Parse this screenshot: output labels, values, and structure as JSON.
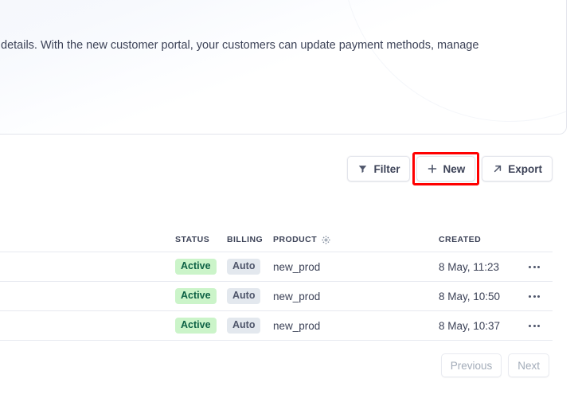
{
  "promo": {
    "text": "details. With the new customer portal, your customers can update payment methods, manage"
  },
  "toolbar": {
    "filter_label": "Filter",
    "filter_icon": "filter-funnel-icon",
    "new_label": "New",
    "new_icon": "plus-icon",
    "export_label": "Export",
    "export_icon": "arrow-up-right-icon",
    "highlight_color": "#ff0000"
  },
  "table": {
    "headers": {
      "spacer": "",
      "status": "STATUS",
      "billing": "BILLING",
      "product": "PRODUCT",
      "product_icon": "gear-icon",
      "created": "CREATED"
    },
    "rows": [
      {
        "status": "Active",
        "billing": "Auto",
        "product": "new_prod",
        "created": "8 May, 11:23",
        "menu_icon": "overflow-menu-icon"
      },
      {
        "status": "Active",
        "billing": "Auto",
        "product": "new_prod",
        "created": "8 May, 10:50",
        "menu_icon": "overflow-menu-icon"
      },
      {
        "status": "Active",
        "billing": "Auto",
        "product": "new_prod",
        "created": "8 May, 10:37",
        "menu_icon": "overflow-menu-icon"
      }
    ],
    "badge_colors": {
      "active_bg": "#cbf4c9",
      "active_text": "#0e6245",
      "auto_bg": "#e3e8ee",
      "auto_text": "#4f566b"
    }
  },
  "pagination": {
    "previous_label": "Previous",
    "next_label": "Next"
  }
}
